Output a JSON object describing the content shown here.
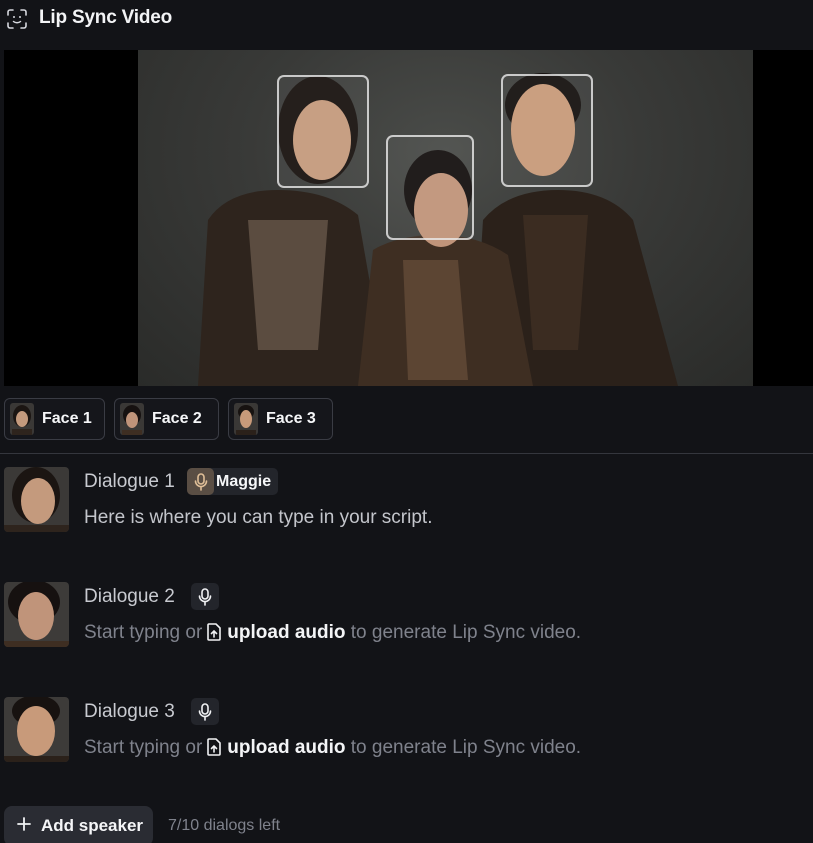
{
  "header": {
    "title": "Lip Sync Video",
    "icon": "face-scan-icon"
  },
  "faces": [
    {
      "label": "Face 1"
    },
    {
      "label": "Face 2"
    },
    {
      "label": "Face 3"
    }
  ],
  "dialogues": [
    {
      "title": "Dialogue 1",
      "voice": "Maggie",
      "text": "Here is where you can type in your script."
    },
    {
      "title": "Dialogue 2",
      "placeholder_start": "Start typing or",
      "upload_label": "upload audio",
      "placeholder_end": "to generate Lip Sync video."
    },
    {
      "title": "Dialogue 3",
      "placeholder_start": "Start typing or",
      "upload_label": "upload audio",
      "placeholder_end": "to generate Lip Sync video."
    }
  ],
  "footer": {
    "add_label": "Add speaker",
    "dialogs_left": "7/10 dialogs left"
  },
  "colors": {
    "background": "#121317",
    "chip_bg": "#23252b",
    "voice_icon_accent": "#d9b48a"
  }
}
